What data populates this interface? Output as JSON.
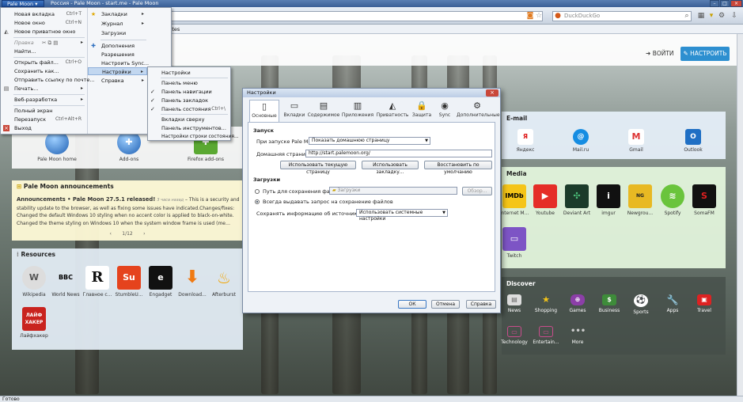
{
  "window": {
    "title": "Россия - Pale Moon - start.me - Pale Moon",
    "app_button": "Pale Moon"
  },
  "navbar": {
    "search_placeholder": "DuckDuckGo"
  },
  "bookmarks": {
    "release_notes": "elease notes"
  },
  "page": {
    "login": "ВОЙТИ",
    "setup": "НАСТРОИТЬ"
  },
  "apps_panel": {
    "items": [
      "Pale Moon home",
      "Add-ons",
      "Firefox add-ons"
    ]
  },
  "announcements": {
    "title": "Pale Moon announcements",
    "headline": "Announcements • Pale Moon 27.5.1 released!",
    "time": "3 часа назад",
    "body": "– This is a security and stability update to the browser, as well as fixing some issues have indicated.Changes/fixes: Changed the default Windows 10 styling when no accent color is applied to black-on-white. Changed the theme styling on Windows 10 when the system window frame is used (me…",
    "pager": "1/12"
  },
  "resources": {
    "title": "Resources",
    "items": [
      "Wikipedia",
      "World News",
      "Главное с...",
      "StumbleU...",
      "Engadget",
      "Download...",
      "Afterburst",
      "Лайфхакер"
    ]
  },
  "email": {
    "title": "E-mail",
    "items": [
      "Яндекс",
      "Mail.ru",
      "Gmail",
      "Outlook"
    ]
  },
  "media": {
    "title": "Media",
    "items": [
      "Internet M...",
      "Youtube",
      "Deviant Art",
      "imgur",
      "Newgrou...",
      "Spotify",
      "SomaFM",
      "Twitch"
    ]
  },
  "discover": {
    "title": "Discover",
    "items": [
      "News",
      "Shopping",
      "Games",
      "Business",
      "Sports",
      "Apps",
      "Travel",
      "Technology",
      "Entertain...",
      "More"
    ]
  },
  "main_menu": {
    "items": [
      {
        "label": "Новая вкладка",
        "shortcut": "Ctrl+T"
      },
      {
        "label": "Новое окно",
        "shortcut": "Ctrl+N"
      },
      {
        "label": "Новое приватное окно",
        "shortcut": ""
      },
      {
        "label": "Правка",
        "shortcut": ""
      },
      {
        "label": "Найти...",
        "shortcut": ""
      },
      {
        "label": "Открыть файл...",
        "shortcut": "Ctrl+O"
      },
      {
        "label": "Сохранить как...",
        "shortcut": ""
      },
      {
        "label": "Отправить ссылку по почте...",
        "shortcut": ""
      },
      {
        "label": "Печать...",
        "shortcut": ""
      },
      {
        "label": "Веб-разработка",
        "shortcut": ""
      },
      {
        "label": "Полный экран",
        "shortcut": ""
      },
      {
        "label": "Перезапуск",
        "shortcut": "Ctrl+Alt+R"
      },
      {
        "label": "Выход",
        "shortcut": ""
      }
    ],
    "right": [
      "Закладки",
      "Журнал",
      "Загрузки",
      "Дополнения",
      "Разрешения",
      "Настроить Sync...",
      "Настройки",
      "Справка"
    ]
  },
  "settings_submenu": {
    "items": [
      "Настройки",
      "Панель меню",
      "Панель навигации",
      "Панель закладок",
      "Панель состояния",
      "Вкладки сверху",
      "Панель инструментов...",
      "Настройки строки состояния..."
    ],
    "state_shortcut": "Ctrl+\\"
  },
  "dialog": {
    "title": "Настройки",
    "tabs": [
      "Основные",
      "Вкладки",
      "Содержимое",
      "Приложения",
      "Приватность",
      "Защита",
      "Sync",
      "Дополнительные"
    ],
    "startup_group": "Запуск",
    "startup_label": "При запуске Pale Moon:",
    "startup_value": "Показать домашнюю страницу",
    "homepage_label": "Домашняя страница:",
    "homepage_value": "http://start.palemoon.org/",
    "btn_current": "Использовать текущую страницу",
    "btn_bookmark": "Использовать закладку...",
    "btn_default": "Восстановить по умолчанию",
    "downloads_group": "Загрузки",
    "save_path_label": "Путь для сохранения файлов",
    "save_path_value": "Загрузки",
    "browse": "Обзор...",
    "always_ask": "Всегда выдавать запрос на сохранение файлов",
    "source_label": "Сохранять информацию об источнике файла:",
    "source_value": "Использовать системные настройки",
    "ok": "ОК",
    "cancel": "Отмена",
    "help": "Справка"
  },
  "status": {
    "text": "Готово"
  }
}
